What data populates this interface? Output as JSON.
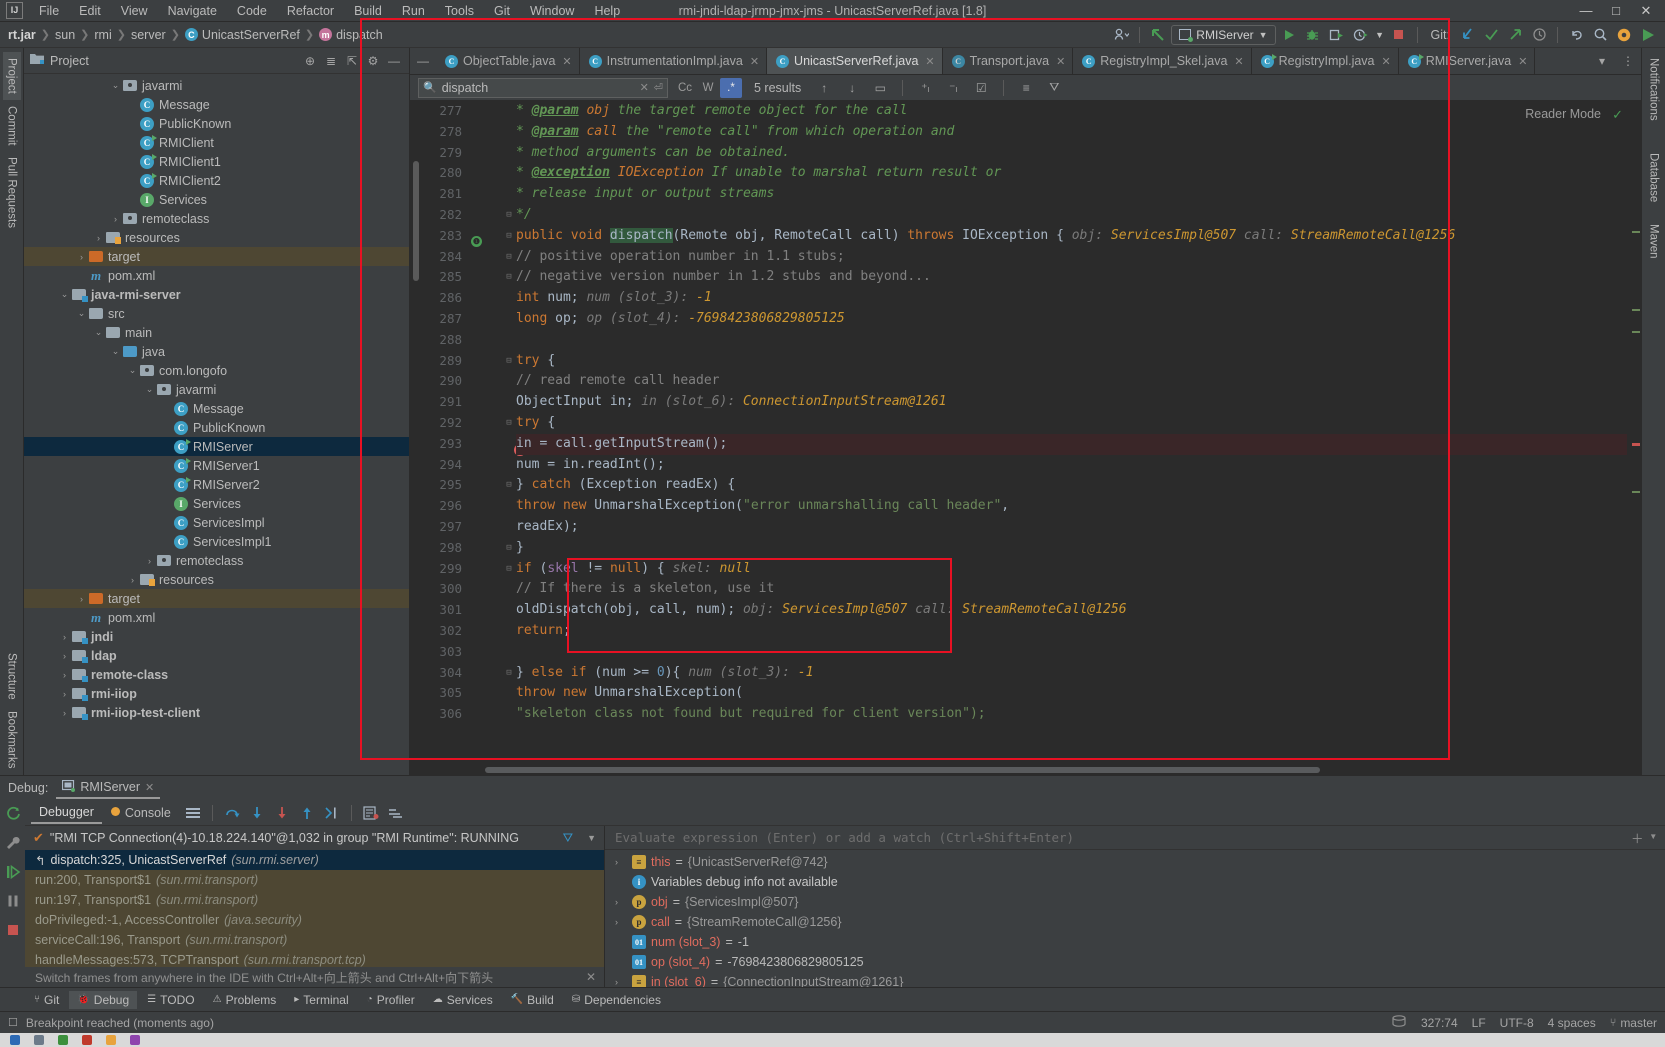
{
  "window": {
    "title": "rmi-jndi-ldap-jrmp-jmx-jms - UnicastServerRef.java [1.8]",
    "logo": "IJ",
    "minimize": "—",
    "maximize": "□",
    "close": "✕"
  },
  "menu": [
    "File",
    "Edit",
    "View",
    "Navigate",
    "Code",
    "Refactor",
    "Build",
    "Run",
    "Tools",
    "Git",
    "Window",
    "Help"
  ],
  "breadcrumb": [
    {
      "label": "rt.jar",
      "icon": "jar-icon",
      "bold": true
    },
    {
      "label": "sun",
      "icon": "package-icon",
      "bold": false
    },
    {
      "label": "rmi",
      "icon": "package-icon",
      "bold": false
    },
    {
      "label": "server",
      "icon": "package-icon",
      "bold": false
    },
    {
      "label": "UnicastServerRef",
      "icon": "class-icon",
      "bold": false
    },
    {
      "label": "dispatch",
      "icon": "method-icon",
      "bold": false
    }
  ],
  "toolbar": {
    "run_config": "RMIServer",
    "git_label": "Git:",
    "icons": [
      "profile-icon",
      "back-arrow-icon",
      "run-icon",
      "debug-icon",
      "run-with-coverage-icon",
      "profiler-icon",
      "stop-icon",
      "update-project-icon",
      "commit-icon",
      "push-icon",
      "history-icon",
      "undo-icon",
      "search-everywhere-icon",
      "settings-icon"
    ]
  },
  "project": {
    "panel_title": "Project",
    "tools": [
      "locate-icon",
      "expand-all-icon",
      "collapse-all-icon",
      "settings-icon",
      "hide-icon"
    ],
    "tree": [
      {
        "depth": 5,
        "arrow": "v",
        "icon": "package-icon",
        "label": "javarmi",
        "bold": false,
        "state": "none"
      },
      {
        "depth": 6,
        "arrow": "",
        "icon": "class-icon",
        "label": "Message",
        "bold": false,
        "state": "none"
      },
      {
        "depth": 6,
        "arrow": "",
        "icon": "class-icon",
        "label": "PublicKnown",
        "bold": false,
        "state": "none"
      },
      {
        "depth": 6,
        "arrow": "",
        "icon": "runnable-class-icon",
        "label": "RMIClient",
        "bold": false,
        "state": "none"
      },
      {
        "depth": 6,
        "arrow": "",
        "icon": "runnable-class-icon",
        "label": "RMIClient1",
        "bold": false,
        "state": "none"
      },
      {
        "depth": 6,
        "arrow": "",
        "icon": "runnable-class-icon",
        "label": "RMIClient2",
        "bold": false,
        "state": "none"
      },
      {
        "depth": 6,
        "arrow": "",
        "icon": "interface-icon",
        "label": "Services",
        "bold": false,
        "state": "none"
      },
      {
        "depth": 5,
        "arrow": ">",
        "icon": "package-icon",
        "label": "remoteclass",
        "bold": false,
        "state": "none"
      },
      {
        "depth": 4,
        "arrow": ">",
        "icon": "resources-folder-icon",
        "label": "resources",
        "bold": false,
        "state": "none"
      },
      {
        "depth": 3,
        "arrow": ">",
        "icon": "target-folder-icon",
        "label": "target",
        "bold": false,
        "state": "highlight"
      },
      {
        "depth": 3,
        "arrow": "",
        "icon": "maven-icon",
        "label": "pom.xml",
        "bold": false,
        "state": "none"
      },
      {
        "depth": 2,
        "arrow": "v",
        "icon": "module-icon",
        "label": "java-rmi-server",
        "bold": true,
        "state": "none"
      },
      {
        "depth": 3,
        "arrow": "v",
        "icon": "folder-icon",
        "label": "src",
        "bold": false,
        "state": "none"
      },
      {
        "depth": 4,
        "arrow": "v",
        "icon": "folder-icon",
        "label": "main",
        "bold": false,
        "state": "none"
      },
      {
        "depth": 5,
        "arrow": "v",
        "icon": "sources-folder-icon",
        "label": "java",
        "bold": false,
        "state": "none"
      },
      {
        "depth": 6,
        "arrow": "v",
        "icon": "package-icon",
        "label": "com.longofo",
        "bold": false,
        "state": "none"
      },
      {
        "depth": 7,
        "arrow": "v",
        "icon": "package-icon",
        "label": "javarmi",
        "bold": false,
        "state": "none"
      },
      {
        "depth": 8,
        "arrow": "",
        "icon": "class-icon",
        "label": "Message",
        "bold": false,
        "state": "none"
      },
      {
        "depth": 8,
        "arrow": "",
        "icon": "class-icon",
        "label": "PublicKnown",
        "bold": false,
        "state": "none"
      },
      {
        "depth": 8,
        "arrow": "",
        "icon": "runnable-class-icon",
        "label": "RMIServer",
        "bold": false,
        "state": "selected"
      },
      {
        "depth": 8,
        "arrow": "",
        "icon": "runnable-class-icon",
        "label": "RMIServer1",
        "bold": false,
        "state": "none"
      },
      {
        "depth": 8,
        "arrow": "",
        "icon": "runnable-class-icon",
        "label": "RMIServer2",
        "bold": false,
        "state": "none"
      },
      {
        "depth": 8,
        "arrow": "",
        "icon": "interface-icon",
        "label": "Services",
        "bold": false,
        "state": "none"
      },
      {
        "depth": 8,
        "arrow": "",
        "icon": "class-icon",
        "label": "ServicesImpl",
        "bold": false,
        "state": "none"
      },
      {
        "depth": 8,
        "arrow": "",
        "icon": "class-icon",
        "label": "ServicesImpl1",
        "bold": false,
        "state": "none"
      },
      {
        "depth": 7,
        "arrow": ">",
        "icon": "package-icon",
        "label": "remoteclass",
        "bold": false,
        "state": "none"
      },
      {
        "depth": 6,
        "arrow": ">",
        "icon": "resources-folder-icon",
        "label": "resources",
        "bold": false,
        "state": "none"
      },
      {
        "depth": 3,
        "arrow": ">",
        "icon": "target-folder-icon",
        "label": "target",
        "bold": false,
        "state": "highlight"
      },
      {
        "depth": 3,
        "arrow": "",
        "icon": "maven-icon",
        "label": "pom.xml",
        "bold": false,
        "state": "none"
      },
      {
        "depth": 2,
        "arrow": ">",
        "icon": "module-icon",
        "label": "jndi",
        "bold": true,
        "state": "none"
      },
      {
        "depth": 2,
        "arrow": ">",
        "icon": "module-icon",
        "label": "ldap",
        "bold": true,
        "state": "none"
      },
      {
        "depth": 2,
        "arrow": ">",
        "icon": "module-icon",
        "label": "remote-class",
        "bold": true,
        "state": "none"
      },
      {
        "depth": 2,
        "arrow": ">",
        "icon": "module-icon",
        "label": "rmi-iiop",
        "bold": true,
        "state": "none"
      },
      {
        "depth": 2,
        "arrow": ">",
        "icon": "module-icon",
        "label": "rmi-iiop-test-client",
        "bold": true,
        "state": "none"
      }
    ]
  },
  "left_rail": [
    "Project",
    "Commit",
    "Pull Requests"
  ],
  "left_rail_bottom": [
    "Structure",
    "Bookmarks"
  ],
  "right_rail": [
    "Notifications",
    "Database",
    "Maven"
  ],
  "editor_tabs": [
    {
      "label": "ObjectTable.java",
      "icon": "class-icon",
      "active": false
    },
    {
      "label": "InstrumentationImpl.java",
      "icon": "class-icon",
      "active": false
    },
    {
      "label": "UnicastServerRef.java",
      "icon": "class-icon",
      "active": true
    },
    {
      "label": "Transport.java",
      "icon": "abstract-class-icon",
      "active": false
    },
    {
      "label": "RegistryImpl_Skel.java",
      "icon": "class-icon",
      "active": false
    },
    {
      "label": "RegistryImpl.java",
      "icon": "runnable-class-icon",
      "active": false
    },
    {
      "label": "RMIServer.java",
      "icon": "runnable-class-icon",
      "active": false
    }
  ],
  "search": {
    "value": "dispatch",
    "placeholder": "Search",
    "results": "5 results",
    "toggles": [
      {
        "label": "Cc",
        "name": "match-case-toggle",
        "on": false
      },
      {
        "label": "W",
        "name": "words-toggle",
        "on": false
      },
      {
        "label": ".*",
        "name": "regex-toggle",
        "on": true
      }
    ],
    "buttons": [
      "prev-match-icon",
      "next-match-icon",
      "select-all-icon",
      "add-line-icon",
      "remove-line-icon",
      "check-lines-icon",
      "open-in-find-window-icon",
      "filter-icon"
    ]
  },
  "reader_mode": "Reader Mode",
  "code": {
    "first_line": 277,
    "lines": [
      {
        "n": 277,
        "html": "<span class='jdoc'>     * </span><span class='jtag'>@param</span><span class='jparam'> obj</span><span class='jdoc'> the target remote object for the call</span>"
      },
      {
        "n": 278,
        "html": "<span class='jdoc'>     * </span><span class='jtag'>@param</span><span class='jparam'> call</span><span class='jdoc'> the \"remote call\" from which operation and</span>"
      },
      {
        "n": 279,
        "html": "<span class='jdoc'>     * method arguments can be obtained.</span>"
      },
      {
        "n": 280,
        "html": "<span class='jdoc'>     * </span><span class='jtag'>@exception</span><span class='jparam'> IOException</span><span class='jdoc'> If unable to marshal return result or</span>"
      },
      {
        "n": 281,
        "html": "<span class='jdoc'>     * release input or output streams</span>"
      },
      {
        "n": 282,
        "html": "<span class='jdoc'>     */</span>"
      },
      {
        "n": 283,
        "html": "<span class='kw'>    public void </span><span class='hlmatch'>dispatch</span><span class='ident'>(Remote obj, RemoteCall call) </span><span class='kw'>throws </span><span class='ident'>IOException {</span><span class='inline-dbg'>   obj: </span><span class='inline-val'>ServicesImpl@507</span><span class='inline-dbg'>    call: </span><span class='inline-val'>StreamRemoteCall@1256</span>"
      },
      {
        "n": 284,
        "html": "<span class='cmt'>        // positive operation number in 1.1 stubs;</span>"
      },
      {
        "n": 285,
        "html": "<span class='cmt'>        // negative version number in 1.2 stubs and beyond...</span>"
      },
      {
        "n": 286,
        "html": "<span class='kw'>        int </span><span class='ident'>num;</span><span class='inline-dbg'>   num (slot_3): </span><span class='inline-val'>-1</span>"
      },
      {
        "n": 287,
        "html": "<span class='kw'>        long </span><span class='ident'>op;</span><span class='inline-dbg'>   op (slot_4): </span><span class='inline-val'>-7698423806829805125</span>"
      },
      {
        "n": 288,
        "html": ""
      },
      {
        "n": 289,
        "html": "<span class='kw'>        try </span><span class='ident'>{</span>"
      },
      {
        "n": 290,
        "html": "<span class='cmt'>            // read remote call header</span>"
      },
      {
        "n": 291,
        "html": "<span class='ident'>            ObjectInput in;</span><span class='inline-dbg'>   in (slot_6): </span><span class='inline-val'>ConnectionInputStream@1261</span>"
      },
      {
        "n": 292,
        "html": "<span class='kw'>            try </span><span class='ident'>{</span>"
      },
      {
        "n": 293,
        "html": "<span class='ident'>                in = call.getInputStream();</span>",
        "highlight": true
      },
      {
        "n": 294,
        "html": "<span class='ident'>                num = in.readInt();</span>"
      },
      {
        "n": 295,
        "html": "<span class='ident'>            } </span><span class='kw'>catch </span><span class='ident'>(Exception readEx) {</span>"
      },
      {
        "n": 296,
        "html": "<span class='kw'>                throw new </span><span class='ident'>UnmarshalException(</span><span class='str'>\"error unmarshalling call header\"</span><span class='ident'>,</span>"
      },
      {
        "n": 297,
        "html": "<span class='ident'>                                              readEx);</span>"
      },
      {
        "n": 298,
        "html": "<span class='ident'>            }</span>"
      },
      {
        "n": 299,
        "html": "<span class='kw'>            if </span><span class='ident'>(</span><span class='ident' style='color:#9876aa'>skel</span><span class='ident'> != </span><span class='kw'>null</span><span class='ident'>) {</span><span class='inline-dbg'>   skel: </span><span class='inline-val'>null</span>"
      },
      {
        "n": 300,
        "html": "<span class='cmt'>                // If there is a skeleton, use it</span>"
      },
      {
        "n": 301,
        "html": "<span class='ident'>                    oldDispatch(obj, call, num);</span><span class='inline-dbg'>  obj: </span><span class='inline-val'>ServicesImpl@507</span><span class='inline-dbg'>   call: </span><span class='inline-val'>StreamRemoteCall@1256</span>"
      },
      {
        "n": 302,
        "html": "<span class='kw'>                    return</span><span class='ident'>;</span>"
      },
      {
        "n": 303,
        "html": ""
      },
      {
        "n": 304,
        "html": "<span class='ident'>            } </span><span class='kw'>else if </span><span class='ident'>(num &gt;= </span><span class='num'>0</span><span class='ident'>){</span><span class='inline-dbg'>  num (slot_3): </span><span class='inline-val'>-1</span>"
      },
      {
        "n": 305,
        "html": "<span class='kw'>                throw new </span><span class='ident'>UnmarshalException(</span>"
      },
      {
        "n": 306,
        "html": "<span class='str'>                    \"skeleton class not found but required for client version\");</span>"
      }
    ]
  },
  "debug": {
    "panel_label": "Debug:",
    "session": "RMIServer",
    "tabs": [
      {
        "label": "Debugger",
        "active": true
      },
      {
        "label": "Console",
        "active": false
      }
    ],
    "toolbar_icons": [
      "layout-icon",
      "step-over-icon",
      "step-into-icon",
      "force-step-into-icon",
      "step-out-icon",
      "run-to-cursor-icon",
      "evaluate-expression-icon",
      "mute-breakpoints-icon"
    ],
    "rail_icons": [
      "rerun-icon",
      "settings-wrench-icon",
      "resume-icon",
      "pause-icon",
      "stop-icon"
    ],
    "thread": "\"RMI TCP Connection(4)-10.18.224.140\"@1,032 in group \"RMI Runtime\": RUNNING",
    "frames": [
      {
        "text": "dispatch:325, UnicastServerRef",
        "pkg": "(sun.rmi.server)",
        "selected": true
      },
      {
        "text": "run:200, Transport$1",
        "pkg": "(sun.rmi.transport)",
        "selected": false
      },
      {
        "text": "run:197, Transport$1",
        "pkg": "(sun.rmi.transport)",
        "selected": false
      },
      {
        "text": "doPrivileged:-1, AccessController",
        "pkg": "(java.security)",
        "selected": false
      },
      {
        "text": "serviceCall:196, Transport",
        "pkg": "(sun.rmi.transport)",
        "selected": false
      },
      {
        "text": "handleMessages:573, TCPTransport",
        "pkg": "(sun.rmi.transport.tcp)",
        "selected": false
      }
    ],
    "frames_hint": "Switch frames from anywhere in the IDE with Ctrl+Alt+向上箭头 and Ctrl+Alt+向下箭头",
    "evaluate_placeholder": "Evaluate expression (Enter) or add a watch (Ctrl+Shift+Enter)",
    "variables": [
      {
        "twisty": ">",
        "badge": "obj",
        "name": "this",
        "value": "{UnicastServerRef@742}",
        "kind": "object"
      },
      {
        "twisty": "",
        "badge": "info",
        "name": "",
        "value": "Variables debug info not available",
        "kind": "info"
      },
      {
        "twisty": ">",
        "badge": "p",
        "name": "obj",
        "value": "{ServicesImpl@507}",
        "kind": "param"
      },
      {
        "twisty": ">",
        "badge": "p",
        "name": "call",
        "value": "{StreamRemoteCall@1256}",
        "kind": "param"
      },
      {
        "twisty": "",
        "badge": "prim",
        "name": "num (slot_3)",
        "value": "-1",
        "kind": "primitive"
      },
      {
        "twisty": "",
        "badge": "prim",
        "name": "op (slot_4)",
        "value": "-7698423806829805125",
        "kind": "primitive"
      },
      {
        "twisty": ">",
        "badge": "obj",
        "name": "in (slot_6)",
        "value": "{ConnectionInputStream@1261}",
        "kind": "object"
      }
    ]
  },
  "bottom_tabs": [
    {
      "label": "Git",
      "icon": "git-icon",
      "active": false
    },
    {
      "label": "Debug",
      "icon": "debug-icon",
      "active": true
    },
    {
      "label": "TODO",
      "icon": "todo-icon",
      "active": false
    },
    {
      "label": "Problems",
      "icon": "problems-icon",
      "active": false
    },
    {
      "label": "Terminal",
      "icon": "terminal-icon",
      "active": false
    },
    {
      "label": "Profiler",
      "icon": "profiler-icon",
      "active": false
    },
    {
      "label": "Services",
      "icon": "services-icon",
      "active": false
    },
    {
      "label": "Build",
      "icon": "build-icon",
      "active": false
    },
    {
      "label": "Dependencies",
      "icon": "dependencies-icon",
      "active": false
    }
  ],
  "status": {
    "message": "Breakpoint reached (moments ago)",
    "position": "327:74",
    "line_sep": "LF",
    "encoding": "UTF-8",
    "indent": "4 spaces",
    "branch": "master",
    "branch_icon": "branch-icon"
  },
  "colors": {
    "accent_blue": "#4b6eaf",
    "annotation_red": "#e81123",
    "selection_blue": "#0d293e",
    "highlight_tan": "#4e4733",
    "editor_bg": "#2b2b2b",
    "panel_bg": "#3c3f41"
  }
}
